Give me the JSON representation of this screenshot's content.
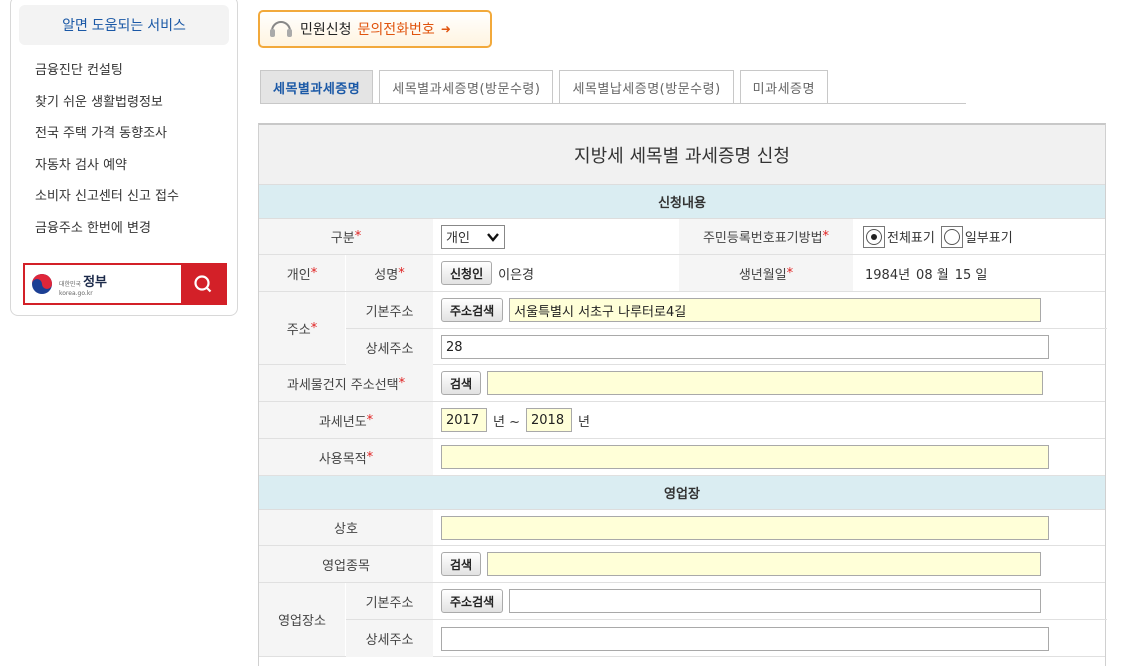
{
  "sidebar": {
    "heading": "알면 도움되는 서비스",
    "items": [
      {
        "label": "금융진단 컨설팅"
      },
      {
        "label": "찾기 쉬운 생활법령정보"
      },
      {
        "label": "전국 주택 가격 동향조사"
      },
      {
        "label": "자동차 검사 예약"
      },
      {
        "label": "소비자 신고센터 신고 접수"
      },
      {
        "label": "금융주소 한번에 변경"
      }
    ],
    "gov_banner": {
      "small_text": "대한민국",
      "brand": "정부",
      "brand_prefix": "대한민국",
      "sub": "korea.go.kr"
    }
  },
  "phone_button": {
    "label1": "민원신청",
    "label2": "문의전화번호",
    "arrow": "➜"
  },
  "tabs": [
    {
      "label": "세목별과세증명",
      "active": true
    },
    {
      "label": "세목별과세증명(방문수령)",
      "active": false
    },
    {
      "label": "세목별납세증명(방문수령)",
      "active": false
    },
    {
      "label": "미과세증명",
      "active": false
    }
  ],
  "form": {
    "title": "지방세 세목별 과세증명 신청",
    "section1": "신청내용",
    "division_label": "구분",
    "division_value": "개인",
    "rrn_label": "주민등록번호표기방법",
    "rrn_opt_full": "전체표기",
    "rrn_opt_partial": "일부표기",
    "personal_label": "개인",
    "name_label": "성명",
    "applicant_btn": "신청인",
    "name_value": "이은경",
    "birth_label": "생년월일",
    "birth_year": "1984년",
    "birth_month": "08 월",
    "birth_day": "15 일",
    "address_label": "주소",
    "basic_address_label": "기본주소",
    "address_search_btn": "주소검색",
    "basic_address_value": "서울특별시 서초구 나루터로4길",
    "detail_address_label": "상세주소",
    "detail_address_value": "28",
    "property_label": "과세물건지 주소선택",
    "search_btn": "검색",
    "property_value": "",
    "year_label": "과세년도",
    "year_from": "2017",
    "year_unit1": "년 ~",
    "year_to": "2018",
    "year_unit2": "년",
    "purpose_label": "사용목적",
    "purpose_value": "",
    "section2": "영업장",
    "trade_name_label": "상호",
    "trade_name_value": "",
    "business_type_label": "영업종목",
    "business_type_value": "",
    "business_place_label": "영업장소",
    "bp_basic_label": "기본주소",
    "bp_basic_value": "",
    "bp_detail_label": "상세주소",
    "bp_detail_value": ""
  },
  "colors": {
    "accent_blue": "#1a58a6",
    "required_red": "#e02020",
    "section_bg": "#daedf2",
    "orange": "#f2a93b",
    "input_yellow": "#ffffd8"
  }
}
